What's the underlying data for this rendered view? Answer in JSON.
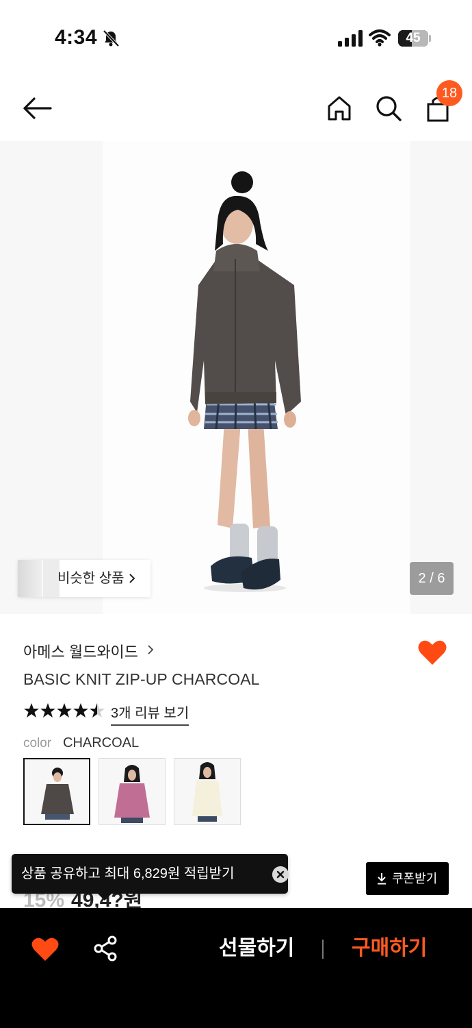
{
  "status_bar": {
    "time": "4:34",
    "battery": "45",
    "battery_level": 0.45
  },
  "nav": {
    "cart_count": "18"
  },
  "gallery": {
    "page_indicator": "2 / 6",
    "similar_label": "비슷한 상품"
  },
  "product": {
    "brand": "아메스 월드와이드",
    "title": "BASIC KNIT ZIP-UP CHARCOAL",
    "rating": 4.5,
    "review_link": "3개 리뷰 보기",
    "color_label": "color",
    "color_value": "CHARCOAL",
    "swatches": [
      "charcoal",
      "pink",
      "ivory"
    ],
    "price_partial": "49,4?원",
    "discount_partial": "15%"
  },
  "toast": {
    "text": "상품 공유하고 최대 6,829원 적립받기"
  },
  "coupon": {
    "label": "쿠폰받기"
  },
  "bottom_bar": {
    "gift_label": "선물하기",
    "buy_label": "구매하기"
  },
  "colors": {
    "accent": "#ff5a1f",
    "bar": "#000000"
  }
}
